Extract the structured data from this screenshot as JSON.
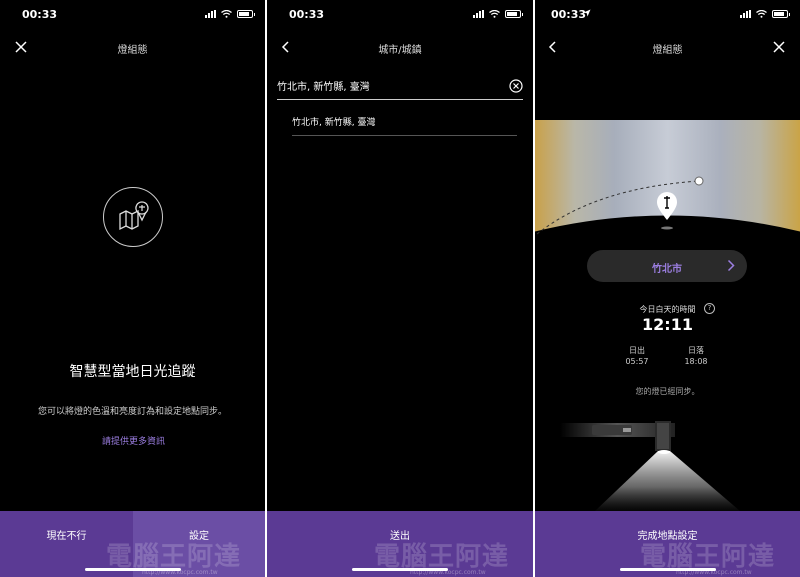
{
  "screens": [
    {
      "status_time": "00:33",
      "nav_title": "燈組態",
      "heading": "智慧型當地日光追蹤",
      "description": "您可以將燈的色溫和亮度訂為和設定地點同步。",
      "link": "請提供更多資訊",
      "button_left": "現在不行",
      "button_right": "設定"
    },
    {
      "status_time": "00:33",
      "nav_title": "城市/城鎮",
      "search_value": "竹北市, 新竹縣, 臺灣",
      "result": "竹北市, 新竹縣, 臺灣",
      "button": "送出"
    },
    {
      "status_time": "00:33",
      "nav_title": "燈組態",
      "city": "竹北市",
      "day_length_label": "今日白天的時間",
      "day_length": "12:11",
      "sunrise_label": "日出",
      "sunrise": "05:57",
      "sunset_label": "日落",
      "sunset": "18:08",
      "synced": "您的燈已經同步。",
      "button": "完成地點設定"
    }
  ],
  "watermark": "電腦王阿達",
  "watermark_url": "http://www.kocpc.com.tw",
  "colors": {
    "accent_bar": "#5b3a94",
    "accent_text": "#9b7ee0"
  }
}
